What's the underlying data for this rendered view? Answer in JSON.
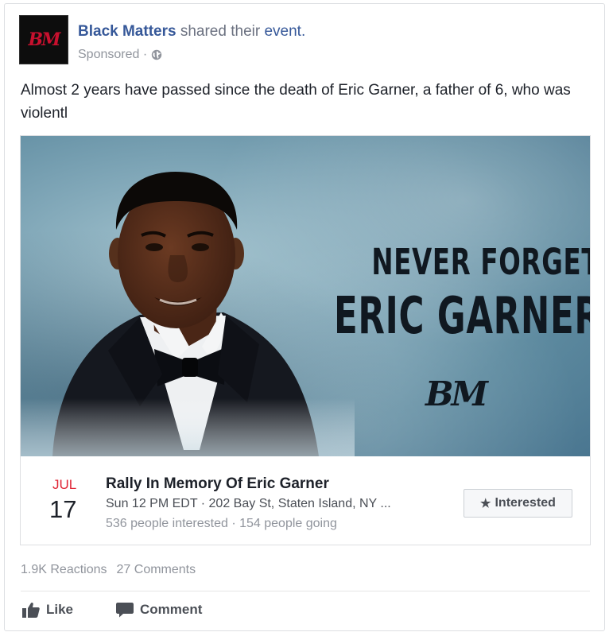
{
  "header": {
    "avatar_text": "BM",
    "page_name": "Black Matters",
    "action_text": "shared their",
    "event_link": "event.",
    "sponsored": "Sponsored ·"
  },
  "post": {
    "text": "Almost 2 years have passed since the death of Eric Garner, a father of 6, who was violentl"
  },
  "event": {
    "image": {
      "line1": "NEVER FORGET",
      "line2": "ERIC GARNER",
      "logo_text": "BM"
    },
    "month": "JUL",
    "day": "17",
    "title": "Rally In Memory Of Eric Garner",
    "when_where": "Sun 12 PM EDT · 202 Bay St, Staten Island, NY ...",
    "counts": "536 people interested · 154 people going",
    "interested_label": "Interested",
    "interested_icon": "star-icon"
  },
  "stats": {
    "reactions": "1.9K Reactions",
    "comments": "27 Comments"
  },
  "actions": {
    "like_label": "Like",
    "like_icon": "thumbs-up-icon",
    "comment_label": "Comment",
    "comment_icon": "speech-bubble-icon"
  },
  "colors": {
    "link": "#365899",
    "month": "#e02636",
    "muted": "#90949c"
  }
}
